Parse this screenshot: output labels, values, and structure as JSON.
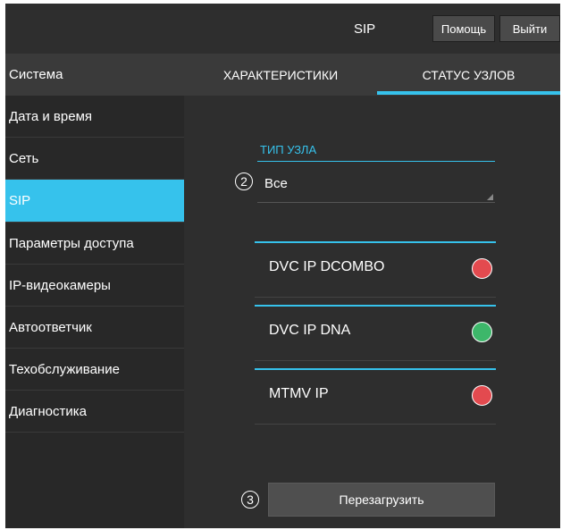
{
  "header": {
    "title": "SIP",
    "help_label": "Помощь",
    "logout_label": "Выйти"
  },
  "sidebar": {
    "items": [
      {
        "label": "Система"
      },
      {
        "label": "Дата и время"
      },
      {
        "label": "Сеть"
      },
      {
        "label": "SIP",
        "active": true
      },
      {
        "label": "Параметры доступа"
      },
      {
        "label": "IP-видеокамеры"
      },
      {
        "label": "Автоответчик"
      },
      {
        "label": "Техобслуживание"
      },
      {
        "label": "Диагностика"
      }
    ]
  },
  "tabs": [
    {
      "label": "ХАРАКТЕРИСТИКИ"
    },
    {
      "label": "СТАТУС УЗЛОВ",
      "active": true
    }
  ],
  "node_type": {
    "label": "ТИП УЗЛА",
    "value": "Все",
    "callout": "2"
  },
  "nodes": [
    {
      "name": "DVC IP DCOMBO",
      "status_color": "#e34a4f"
    },
    {
      "name": "DVC IP DNA",
      "status_color": "#3db76a"
    },
    {
      "name": "MTMV IP",
      "status_color": "#e34a4f"
    }
  ],
  "reboot": {
    "label": "Перезагрузить",
    "callout": "3"
  },
  "colors": {
    "accent": "#36c2ec",
    "background": "#2e2e2e",
    "status_offline": "#e34a4f",
    "status_online": "#3db76a"
  }
}
